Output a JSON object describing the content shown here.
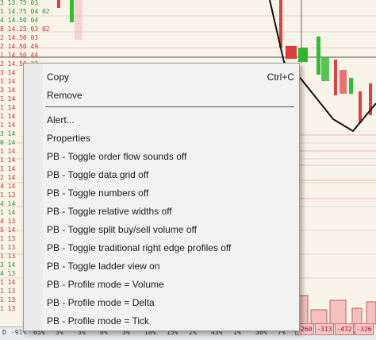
{
  "ladder": [
    {
      "text": "3 13.75 03",
      "color": "#2e8b2e"
    },
    {
      "text": "1 14.75 04 02",
      "color": "#2e8b2e"
    },
    {
      "text": "4 14.50 04",
      "color": "#2e8b2e"
    },
    {
      "text": "8 14.25 03 02",
      "color": "#d03030"
    },
    {
      "text": "2 14.50 03",
      "color": "#d03030"
    },
    {
      "text": "2 14.50 49",
      "color": "#d03030"
    },
    {
      "text": "1 14.50 44",
      "color": "#d03030"
    },
    {
      "text": "2 14.50 32",
      "color": "#d03030"
    },
    {
      "text": "3 14",
      "color": "#d03030"
    },
    {
      "text": "1 14",
      "color": "#d03030"
    },
    {
      "text": "3 14",
      "color": "#d03030"
    },
    {
      "text": "1 14",
      "color": "#d03030"
    },
    {
      "text": "1 14",
      "color": "#d03030"
    },
    {
      "text": "1 14",
      "color": "#d03030"
    },
    {
      "text": "1 14",
      "color": "#d03030"
    },
    {
      "text": "3 14",
      "color": "#2e8b2e"
    },
    {
      "text": "0 14",
      "color": "#2e8b2e"
    },
    {
      "text": "1 14",
      "color": "#d03030"
    },
    {
      "text": "1 14",
      "color": "#d03030"
    },
    {
      "text": "1 14",
      "color": "#d03030"
    },
    {
      "text": "2 14",
      "color": "#d03030"
    },
    {
      "text": "4 14",
      "color": "#d03030"
    },
    {
      "text": "1 13",
      "color": "#d03030"
    },
    {
      "text": "4 14",
      "color": "#2e8b2e"
    },
    {
      "text": "1 14",
      "color": "#2e8b2e"
    },
    {
      "text": "4 13",
      "color": "#d03030"
    },
    {
      "text": "5 14",
      "color": "#d03030"
    },
    {
      "text": "1 13",
      "color": "#d03030"
    },
    {
      "text": "1 13",
      "color": "#d03030"
    },
    {
      "text": "1 13",
      "color": "#d03030"
    },
    {
      "text": "3 14",
      "color": "#2e8b2e"
    },
    {
      "text": "4 13",
      "color": "#2e8b2e"
    },
    {
      "text": "1 14",
      "color": "#d03030"
    },
    {
      "text": "1 13",
      "color": "#d03030"
    },
    {
      "text": "1 13",
      "color": "#d03030"
    },
    {
      "text": "1 13",
      "color": "#d03030"
    }
  ],
  "bottom_stats": [
    "-91%",
    "65%",
    "3%",
    "3%",
    "0%",
    "3%",
    "18%",
    "15%",
    "2%",
    "43%",
    "1%",
    "36%",
    "7%",
    "31%",
    "11%",
    "11%"
  ],
  "delta_cells": [
    "-260",
    "-313",
    "-472",
    "-326"
  ],
  "corner_label": "D",
  "context_menu": {
    "items": [
      {
        "label": "Copy",
        "shortcut": "Ctrl+C"
      },
      {
        "label": "Remove",
        "shortcut": ""
      },
      {
        "label": "Alert...",
        "shortcut": ""
      },
      {
        "label": "Properties",
        "shortcut": ""
      },
      {
        "label": "PB - Toggle order flow sounds off",
        "shortcut": ""
      },
      {
        "label": "PB - Toggle data grid off",
        "shortcut": ""
      },
      {
        "label": "PB - Toggle numbers off",
        "shortcut": ""
      },
      {
        "label": "PB - Toggle relative widths off",
        "shortcut": ""
      },
      {
        "label": "PB - Toggle split buy/sell volume off",
        "shortcut": ""
      },
      {
        "label": "PB - Toggle traditional right edge profiles off",
        "shortcut": ""
      },
      {
        "label": "PB - Toggle ladder view on",
        "shortcut": ""
      },
      {
        "label": "PB - Profile mode = Volume",
        "shortcut": ""
      },
      {
        "label": "PB - Profile mode = Delta",
        "shortcut": ""
      },
      {
        "label": "PB - Profile mode = Tick",
        "shortcut": ""
      }
    ]
  },
  "colors": {
    "bull_candle": "#2fbf2f",
    "bear_candle": "#e04040",
    "buy_profile": "#2fb52f",
    "sell_profile": "#e03a3a",
    "trend_line": "#111111",
    "menu_bg": "#f2f2f2"
  }
}
